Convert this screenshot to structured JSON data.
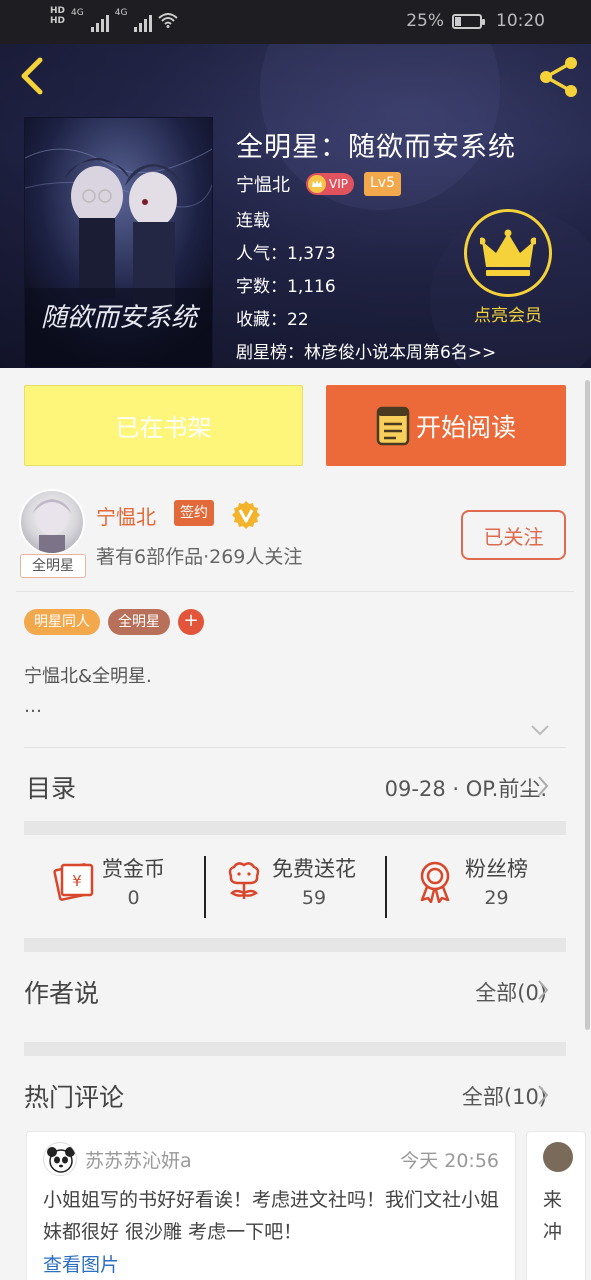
{
  "status_bar": {
    "network_left": "HD",
    "network_right": "HD",
    "signal_label_1": "4G",
    "signal_label_2": "4G",
    "battery_percent": "25%",
    "time": "10:20"
  },
  "book": {
    "title": "全明星：随欲而安系统",
    "author": "宁愠北",
    "vip_label": "VIP",
    "level": "Lv5",
    "status": "连载",
    "popularity": "人气：1,373",
    "word_count": "字数：1,116",
    "favorites": "收藏：22",
    "ranking": "剧星榜：林彦俊小说本周第6名>>",
    "cover_art_text": "随欲而安系统",
    "member_label": "点亮会员"
  },
  "actions": {
    "shelf_label": "已在书架",
    "read_label": "开始阅读"
  },
  "author_card": {
    "name": "宁愠北",
    "sign_badge": "签约",
    "avatar_tag": "全明星",
    "stats": "著有6部作品·269人关注",
    "follow_label": "已关注"
  },
  "tags": [
    "明星同人",
    "全明星"
  ],
  "tag_add": "+",
  "intro": {
    "line1": "宁愠北&全明星.",
    "line2": "…"
  },
  "toc": {
    "title": "目录",
    "latest": "09-28 · OP.前尘."
  },
  "stats": [
    {
      "label": "赏金币",
      "value": "0"
    },
    {
      "label": "免费送花",
      "value": "59"
    },
    {
      "label": "粉丝榜",
      "value": "29"
    }
  ],
  "author_says": {
    "title": "作者说",
    "all_label": "全部(0)"
  },
  "hot_comments": {
    "title": "热门评论",
    "all_label": "全部(10)",
    "items": [
      {
        "user": "苏苏苏沁妍a",
        "time": "今天 20:56",
        "text": "小姐姐写的书好好看诶！考虑进文社吗！我们文社小姐妹都很好 很沙雕 考虑一下吧！",
        "link": "查看图片"
      }
    ],
    "peek_text": "来冲"
  }
}
